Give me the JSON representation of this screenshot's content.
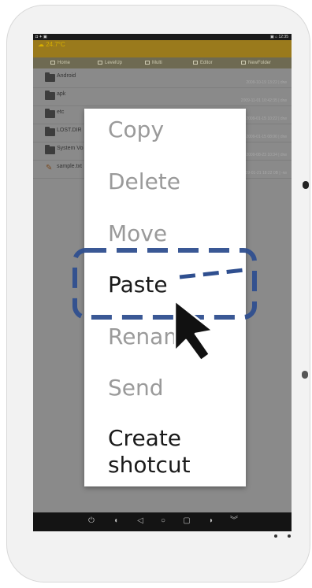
{
  "statusbar": {
    "left": "◘ ✈ ▣",
    "right": "▣ ⌂ 12:35"
  },
  "weather": "☁ 24.7°C",
  "tabs": [
    {
      "label": "Home",
      "icon": "home-icon"
    },
    {
      "label": "LevelUp",
      "icon": "folder-up-icon"
    },
    {
      "label": "Multi",
      "icon": "multi-select-icon"
    },
    {
      "label": "Editor",
      "icon": "edit-icon"
    },
    {
      "label": "NewFolder",
      "icon": "new-folder-icon"
    }
  ],
  "files": [
    {
      "name": "Android",
      "meta": "2009-10-19 13:22 | drw",
      "type": "folder"
    },
    {
      "name": "apk",
      "meta": "2009-11-01 10:42:35 | drw",
      "type": "folder"
    },
    {
      "name": "etc",
      "meta": "2009-01-15 10:22 | drw",
      "type": "folder"
    },
    {
      "name": "LOST.DIR",
      "meta": "2009-01-15 08:00 | drw",
      "type": "folder"
    },
    {
      "name": "System Vo",
      "meta": "2009-08-23 10:34 | drw",
      "type": "folder"
    },
    {
      "name": "sample.txt",
      "meta": "2009-01-21 18:22 0B | -rw",
      "type": "file"
    }
  ],
  "menu": {
    "items": [
      {
        "label": "Copy",
        "state": "disabled"
      },
      {
        "label": "Delete",
        "state": "disabled"
      },
      {
        "label": "Move",
        "state": "disabled"
      },
      {
        "label": "Paste",
        "state": "enabled"
      },
      {
        "label": "Renam",
        "state": "disabled"
      },
      {
        "label": "Send",
        "state": "disabled"
      },
      {
        "label_line1": "Create",
        "label_line2": "shotcut",
        "state": "enabled"
      }
    ]
  },
  "navbar": [
    "power-icon",
    "volume-down-icon",
    "back-icon",
    "home-circle-icon",
    "recent-apps-icon",
    "volume-up-icon",
    "expand-icon"
  ],
  "colors": {
    "highlight": "#2f4f8f",
    "appbar": "#9a7a1c",
    "tabs": "#6e6a52"
  }
}
